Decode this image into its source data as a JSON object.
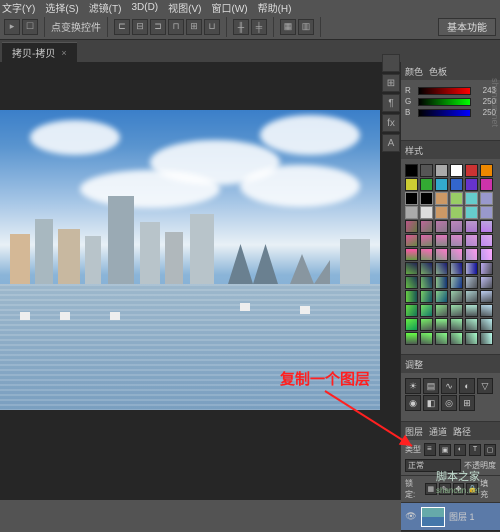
{
  "menu": {
    "items": [
      "文字(Y)",
      "选择(S)",
      "滤镜(T)",
      "3D(D)",
      "视图(V)",
      "窗口(W)",
      "帮助(H)"
    ]
  },
  "options": {
    "label": "点变换控件",
    "workspace": "基本功能"
  },
  "tab": {
    "title": "拷贝-拷贝",
    "close": "×"
  },
  "panels": {
    "color": {
      "title": "颜色",
      "tab2": "色板",
      "sliders": [
        {
          "lbl": "R",
          "val": "243"
        },
        {
          "lbl": "G",
          "val": "250"
        },
        {
          "lbl": "B",
          "val": "250"
        }
      ]
    },
    "styles": {
      "title": "样式"
    },
    "adjust": {
      "title": "调整"
    },
    "layers": {
      "title": "图层",
      "tab2": "通道",
      "tab3": "路径",
      "kind": "类型",
      "blend": "正常",
      "opacity_lbl": "不透明度",
      "lock_lbl": "锁定:",
      "fill_lbl": "填充",
      "layer1": "图层 1"
    }
  },
  "annotation": {
    "text": "复制一个图层"
  },
  "watermark": {
    "text": "脚本之家",
    "site": "shancun.net"
  },
  "vtabs": [
    "",
    "⊞",
    "¶",
    "fx",
    "A"
  ]
}
